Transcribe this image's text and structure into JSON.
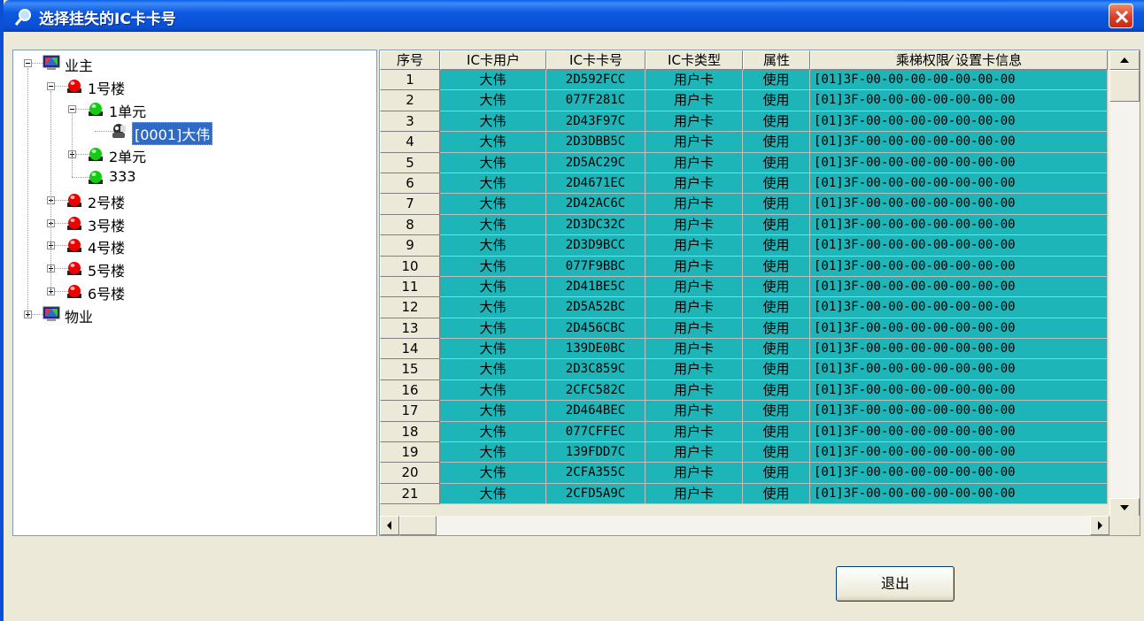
{
  "window": {
    "title": "选择挂失的IC卡卡号",
    "title_icon": "magnifier-icon",
    "close_icon": "close-icon"
  },
  "tree": {
    "nodes": [
      {
        "label": "业主",
        "icon": "monitor-icon",
        "expanded": true,
        "level": 0
      },
      {
        "label": "1号楼",
        "icon": "red-light-icon",
        "expanded": true,
        "level": 1
      },
      {
        "label": "1单元",
        "icon": "green-light-icon",
        "expanded": true,
        "level": 2
      },
      {
        "label": "[0001]大伟",
        "icon": "user-icon",
        "selected": true,
        "level": 3
      },
      {
        "label": "2单元",
        "icon": "green-light-icon",
        "expanded": false,
        "level": 2
      },
      {
        "label": "333",
        "icon": "green-light-icon",
        "level": 2
      },
      {
        "label": "2号楼",
        "icon": "red-light-icon",
        "expanded": false,
        "level": 1
      },
      {
        "label": "3号楼",
        "icon": "red-light-icon",
        "expanded": false,
        "level": 1
      },
      {
        "label": "4号楼",
        "icon": "red-light-icon",
        "expanded": false,
        "level": 1
      },
      {
        "label": "5号楼",
        "icon": "red-light-icon",
        "expanded": false,
        "level": 1
      },
      {
        "label": "6号楼",
        "icon": "red-light-icon",
        "expanded": false,
        "level": 1
      },
      {
        "label": "物业",
        "icon": "monitor-icon",
        "expanded": false,
        "level": 0
      }
    ]
  },
  "grid": {
    "columns": [
      "序号",
      "IC卡用户",
      "IC卡卡号",
      "IC卡类型",
      "属性",
      "乘梯权限⁄ 设置卡信息"
    ],
    "rows": [
      [
        "1",
        "大伟",
        "2D592FCC",
        "用户卡",
        "使用",
        "[01]3F-00-00-00-00-00-00-00"
      ],
      [
        "2",
        "大伟",
        "077F281C",
        "用户卡",
        "使用",
        "[01]3F-00-00-00-00-00-00-00"
      ],
      [
        "3",
        "大伟",
        "2D43F97C",
        "用户卡",
        "使用",
        "[01]3F-00-00-00-00-00-00-00"
      ],
      [
        "4",
        "大伟",
        "2D3DBB5C",
        "用户卡",
        "使用",
        "[01]3F-00-00-00-00-00-00-00"
      ],
      [
        "5",
        "大伟",
        "2D5AC29C",
        "用户卡",
        "使用",
        "[01]3F-00-00-00-00-00-00-00"
      ],
      [
        "6",
        "大伟",
        "2D4671EC",
        "用户卡",
        "使用",
        "[01]3F-00-00-00-00-00-00-00"
      ],
      [
        "7",
        "大伟",
        "2D42AC6C",
        "用户卡",
        "使用",
        "[01]3F-00-00-00-00-00-00-00"
      ],
      [
        "8",
        "大伟",
        "2D3DC32C",
        "用户卡",
        "使用",
        "[01]3F-00-00-00-00-00-00-00"
      ],
      [
        "9",
        "大伟",
        "2D3D9BCC",
        "用户卡",
        "使用",
        "[01]3F-00-00-00-00-00-00-00"
      ],
      [
        "10",
        "大伟",
        "077F9BBC",
        "用户卡",
        "使用",
        "[01]3F-00-00-00-00-00-00-00"
      ],
      [
        "11",
        "大伟",
        "2D41BE5C",
        "用户卡",
        "使用",
        "[01]3F-00-00-00-00-00-00-00"
      ],
      [
        "12",
        "大伟",
        "2D5A52BC",
        "用户卡",
        "使用",
        "[01]3F-00-00-00-00-00-00-00"
      ],
      [
        "13",
        "大伟",
        "2D456CBC",
        "用户卡",
        "使用",
        "[01]3F-00-00-00-00-00-00-00"
      ],
      [
        "14",
        "大伟",
        "139DE0BC",
        "用户卡",
        "使用",
        "[01]3F-00-00-00-00-00-00-00"
      ],
      [
        "15",
        "大伟",
        "2D3C859C",
        "用户卡",
        "使用",
        "[01]3F-00-00-00-00-00-00-00"
      ],
      [
        "16",
        "大伟",
        "2CFC582C",
        "用户卡",
        "使用",
        "[01]3F-00-00-00-00-00-00-00"
      ],
      [
        "17",
        "大伟",
        "2D464BEC",
        "用户卡",
        "使用",
        "[01]3F-00-00-00-00-00-00-00"
      ],
      [
        "18",
        "大伟",
        "077CFFEC",
        "用户卡",
        "使用",
        "[01]3F-00-00-00-00-00-00-00"
      ],
      [
        "19",
        "大伟",
        "139FDD7C",
        "用户卡",
        "使用",
        "[01]3F-00-00-00-00-00-00-00"
      ],
      [
        "20",
        "大伟",
        "2CFA355C",
        "用户卡",
        "使用",
        "[01]3F-00-00-00-00-00-00-00"
      ],
      [
        "21",
        "大伟",
        "2CFD5A9C",
        "用户卡",
        "使用",
        "[01]3F-00-00-00-00-00-00-00"
      ]
    ]
  },
  "footer": {
    "exit_label": "退出"
  },
  "colors": {
    "title_bar": "#0a4fd4",
    "row_fill": "#1eb5b8",
    "selection": "#316ac5",
    "close": "#d8402a"
  }
}
